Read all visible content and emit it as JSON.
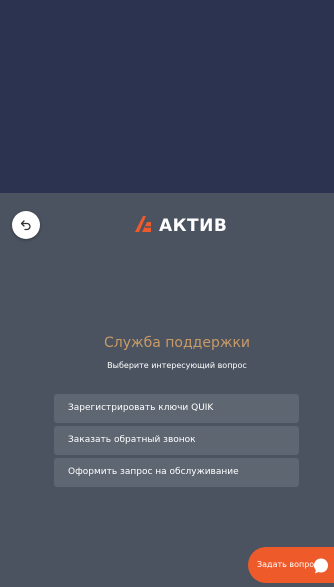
{
  "colors": {
    "top_background": "#2b3350",
    "panel_background": "#4b5360",
    "option_background": "#5e6672",
    "title_color": "#c99a66",
    "logo_accent": "#ef5a2b",
    "ask_button": "#ef5a2b"
  },
  "header": {
    "back_icon": "undo-arrow-icon",
    "logo_icon": "aktiv-logo-icon",
    "logo_text": "АКТИВ"
  },
  "support": {
    "title": "Служба поддержки",
    "subtitle": "Выберите интересующий вопрос",
    "options": [
      {
        "label": "Зарегистрировать ключи QUIK"
      },
      {
        "label": "Заказать обратный звонок"
      },
      {
        "label": "Оформить запрос на обслуживание"
      }
    ]
  },
  "ask_button": {
    "label": "Задать вопрос",
    "icon": "chat-bubble-icon"
  }
}
